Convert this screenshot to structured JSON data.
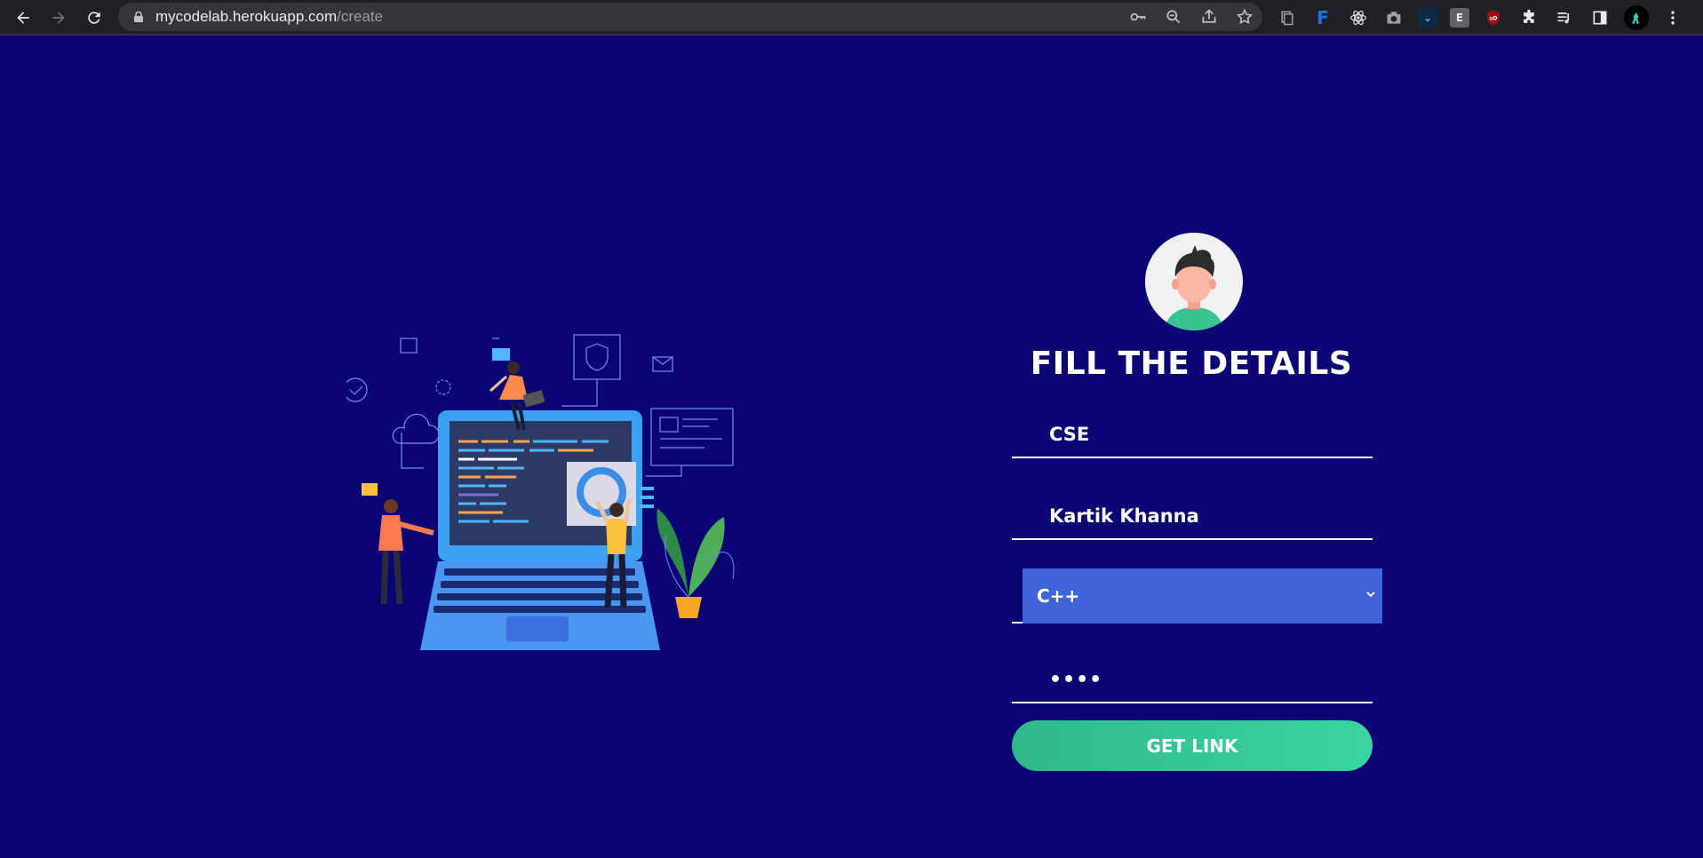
{
  "browser": {
    "url_host": "mycodelab.herokuapp.com",
    "url_path": "/create",
    "extensions": [
      "docs-icon",
      "f-extension-icon",
      "react-devtools-icon",
      "camera-icon",
      "v-extension-icon",
      "E",
      "ublock-icon",
      "puzzle-icon",
      "media-icon",
      "sidebar-icon",
      "profile-avatar",
      "menu-icon"
    ]
  },
  "form": {
    "title": "FILL THE DETAILS",
    "field1_value": "CSE",
    "field2_value": "Kartik Khanna",
    "language_selected": "C++",
    "password_value": "••••",
    "submit_label": "GET LINK"
  },
  "colors": {
    "page_bg": "#0a0475",
    "select_bg": "#3f64d8",
    "button_green": "#34c997"
  }
}
